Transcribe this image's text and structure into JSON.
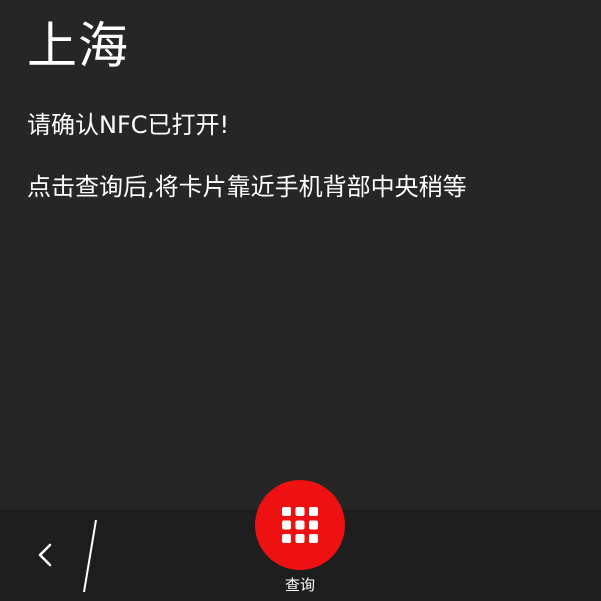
{
  "header": {
    "city": "上海"
  },
  "instructions": {
    "line1": "请确认NFC已打开!",
    "line2": "点击查询后,将卡片靠近手机背部中央稍等"
  },
  "bottom_bar": {
    "back_icon": "chevron-left-icon",
    "query_icon": "grid-icon",
    "query_label": "查询"
  },
  "colors": {
    "background": "#262626",
    "bottom_bar": "#1e1e1e",
    "accent": "#ee1111",
    "text": "#ffffff"
  }
}
